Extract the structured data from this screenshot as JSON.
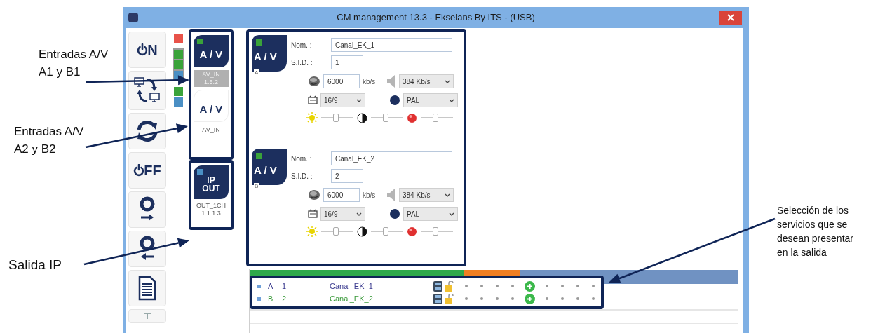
{
  "window": {
    "title": "CM management 13.3 - Ekselans By ITS - (USB)"
  },
  "toolbar": [
    {
      "kind": "on",
      "label": "N"
    },
    {
      "kind": "swap"
    },
    {
      "kind": "refresh"
    },
    {
      "kind": "off",
      "label": "FF"
    },
    {
      "kind": "disc_out"
    },
    {
      "kind": "disc_in"
    },
    {
      "kind": "document"
    },
    {
      "kind": "partial"
    }
  ],
  "status_led_groups": [
    {
      "kind": "plain",
      "leds": [
        {
          "color": "#e8534a"
        }
      ]
    },
    {
      "kind": "framed",
      "leds": [
        {
          "color": "#3aa33a"
        },
        {
          "color": "#3aa33a"
        },
        {
          "color": "#4a8fc4"
        }
      ]
    },
    {
      "kind": "plain",
      "leds": [
        {
          "color": "#3aa33a"
        },
        {
          "color": "#4a8fc4"
        }
      ]
    }
  ],
  "modules": [
    {
      "kind": "av",
      "selected": true,
      "color": "#3aa33a",
      "title_lines": [
        "A / V"
      ],
      "label_lines": [
        "AV_IN",
        "1.5.2"
      ]
    },
    {
      "kind": "av",
      "selected": false,
      "title_lines": [
        "A / V"
      ],
      "label_lines": [
        "AV_IN"
      ]
    },
    {
      "kind": "ip",
      "selected": true,
      "color": "#4a8fc4",
      "title_lines": [
        "IP",
        "OUT"
      ],
      "label_lines": [
        "OUT_1CH",
        "1.1.1.3"
      ]
    }
  ],
  "channels": [
    {
      "badge": "A / V",
      "sub": "A",
      "name_label": "Nom. :",
      "name": "Canal_EK_1",
      "sid_label": "S.I.D. :",
      "sid": "1",
      "bitrate": "6000",
      "bitrate_unit": "kb/s",
      "audio": "384 Kb/s",
      "aspect": "16/9",
      "standard": "PAL",
      "sliders": [
        {
          "level": 0.45
        },
        {
          "level": 0.45
        },
        {
          "level": 0.45
        }
      ]
    },
    {
      "badge": "A / V",
      "sub": "B",
      "name_label": "Nom. :",
      "name": "Canal_EK_2",
      "sid_label": "S.I.D. :",
      "sid": "2",
      "bitrate": "6000",
      "bitrate_unit": "kb/s",
      "audio": "384 Kb/s",
      "aspect": "16/9",
      "standard": "PAL",
      "sliders": [
        {
          "level": 0.45
        },
        {
          "level": 0.45
        },
        {
          "level": 0.45
        }
      ]
    }
  ],
  "services": {
    "rows": [
      {
        "input": "A",
        "sid": "1",
        "name": "Canal_EK_1",
        "color": "#3b3b8f"
      },
      {
        "input": "B",
        "sid": "2",
        "name": "Canal_EK_2",
        "color": "#3a9a3a"
      }
    ]
  },
  "annotations": [
    {
      "kind": "left",
      "lines": [
        "Entradas A/V",
        "A1 y B1"
      ]
    },
    {
      "kind": "left",
      "lines": [
        "Entradas A/V",
        "A2 y B2"
      ]
    },
    {
      "kind": "left_big",
      "lines": [
        "Salida IP"
      ]
    },
    {
      "kind": "right",
      "lines": [
        "Selección de los",
        "servicios que se",
        "desean presentar",
        "en la salida"
      ]
    }
  ]
}
